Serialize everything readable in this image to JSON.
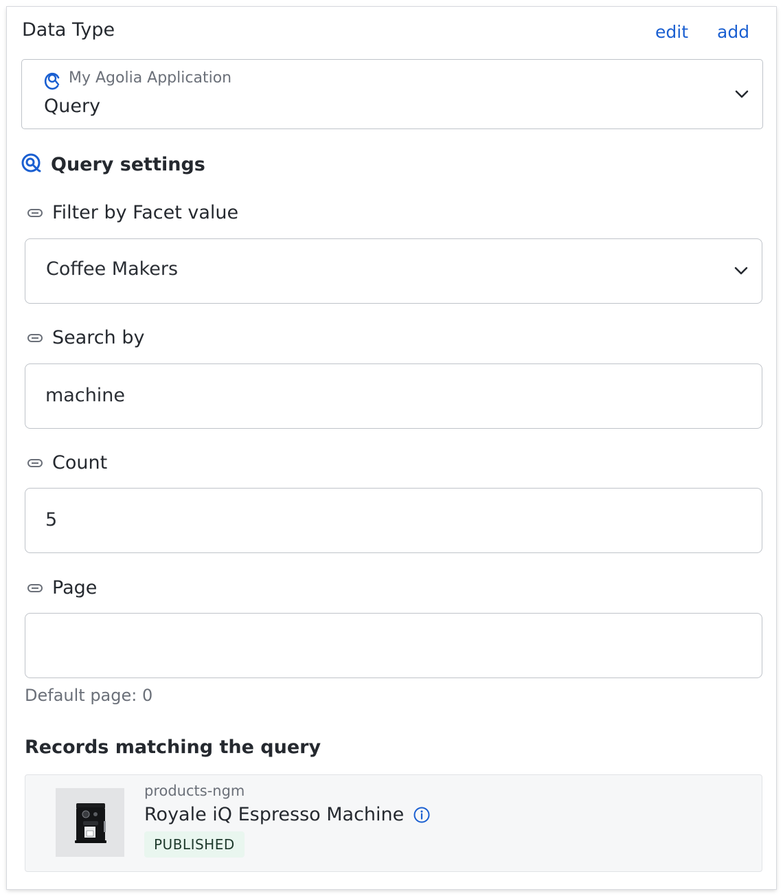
{
  "header": {
    "title": "Data Type",
    "edit_label": "edit",
    "add_label": "add"
  },
  "app_select": {
    "app_name": "My Agolia Application",
    "value": "Query"
  },
  "section": {
    "title": "Query settings"
  },
  "fields": {
    "facet": {
      "label": "Filter by Facet value",
      "value": "Coffee Makers"
    },
    "search": {
      "label": "Search by",
      "value": "machine"
    },
    "count": {
      "label": "Count",
      "value": "5"
    },
    "page": {
      "label": "Page",
      "value": "",
      "hint": "Default page: 0"
    }
  },
  "records": {
    "title": "Records matching the query",
    "items": [
      {
        "index": "products-ngm",
        "name": "Royale iQ Espresso Machine",
        "status": "PUBLISHED"
      }
    ]
  },
  "colors": {
    "accent": "#1a5fd1",
    "badge_bg": "#e9f6ef",
    "border": "#bfc3c9"
  },
  "icons": {
    "app": "algolia-icon",
    "section": "algolia-icon",
    "field": "link-icon",
    "dropdown": "chevron-down-icon",
    "info": "info-icon"
  }
}
